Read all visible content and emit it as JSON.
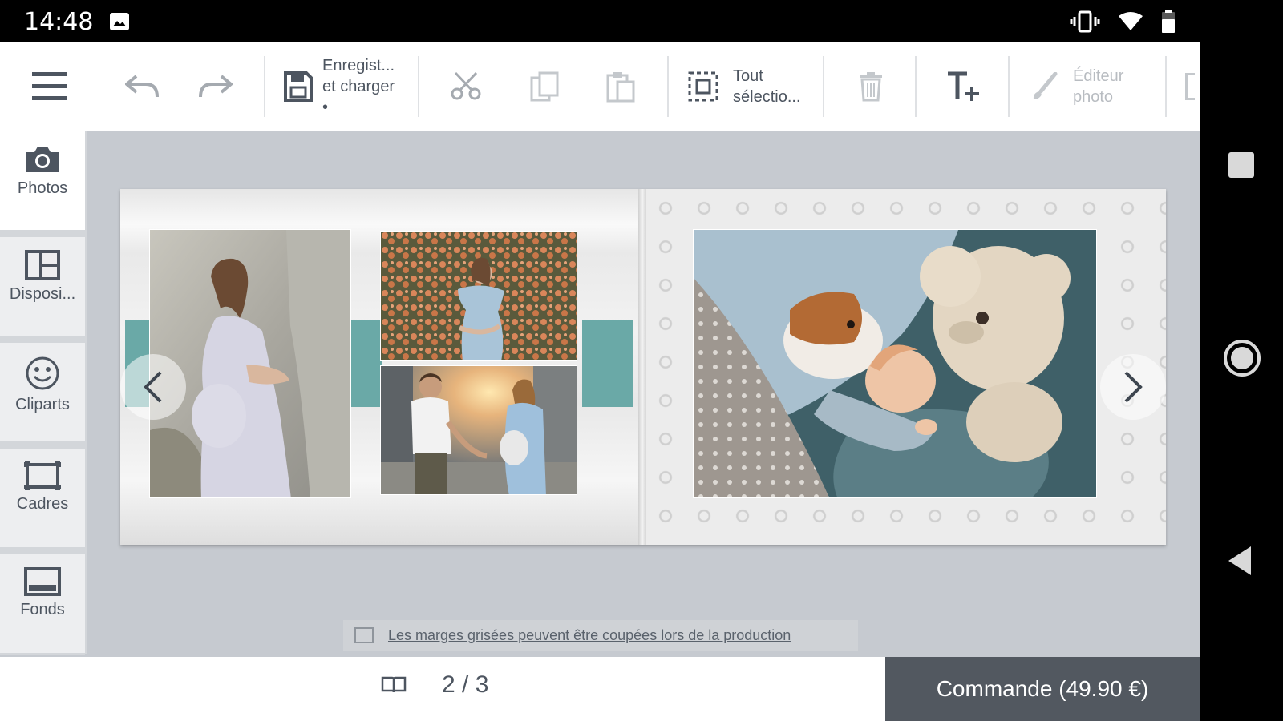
{
  "status": {
    "time": "14:48"
  },
  "toolbar": {
    "save_label": "Enregist...\net charger\n•",
    "select_all_label": "Tout\nsélectio...",
    "photo_editor_label": "Éditeur\nphoto"
  },
  "sidebar": {
    "items": [
      {
        "label": "Photos",
        "icon": "camera-icon"
      },
      {
        "label": "Disposi...",
        "icon": "layout-icon"
      },
      {
        "label": "Cliparts",
        "icon": "smiley-icon"
      },
      {
        "label": "Cadres",
        "icon": "frame-icon"
      },
      {
        "label": "Fonds",
        "icon": "background-icon"
      }
    ]
  },
  "canvas": {
    "margin_notice": "Les marges grisées peuvent être coupées lors de la production",
    "photos": [
      {
        "name": "pregnant-woman-rocks-photo"
      },
      {
        "name": "pregnant-woman-flowers-photo"
      },
      {
        "name": "couple-holding-hands-photo"
      },
      {
        "name": "baby-teddy-dog-photo"
      }
    ]
  },
  "footer": {
    "page_indicator": "2 / 3",
    "order_button": "Commande (49.90 €)"
  },
  "colors": {
    "accent_teal": "#6aa9a7",
    "order_button_bg": "#525860",
    "workspace_bg": "#c6cad0"
  }
}
